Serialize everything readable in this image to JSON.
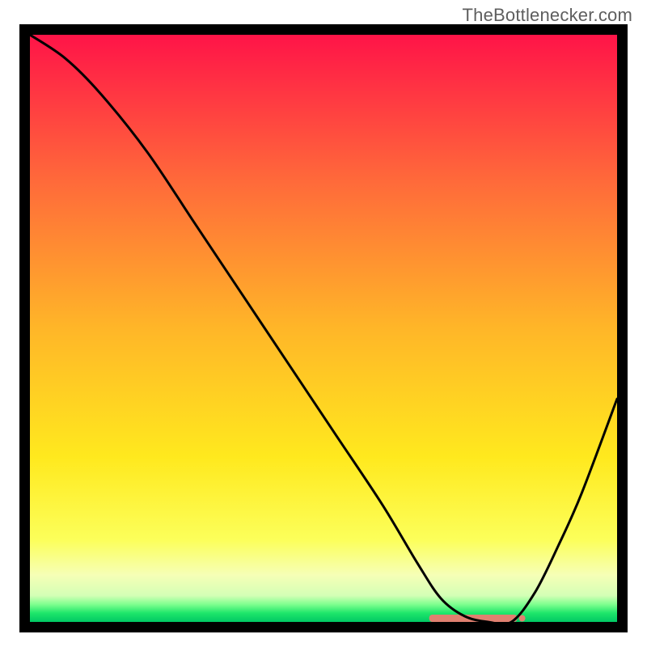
{
  "watermark": "TheBottlenecker.com",
  "chart_data": {
    "type": "line",
    "title": "",
    "xlabel": "",
    "ylabel": "",
    "xlim": [
      0,
      100
    ],
    "ylim": [
      0,
      100
    ],
    "x": [
      0,
      6,
      12,
      20,
      28,
      36,
      44,
      52,
      60,
      66,
      70,
      74,
      78,
      82,
      86,
      90,
      94,
      100
    ],
    "values": [
      100,
      96,
      90,
      80,
      68,
      56,
      44,
      32,
      20,
      10,
      4,
      1,
      0,
      0,
      5,
      13,
      22,
      38
    ],
    "background_gradient_stops": [
      {
        "offset": 0,
        "color": "#ff1448"
      },
      {
        "offset": 0.25,
        "color": "#ff6a3a"
      },
      {
        "offset": 0.5,
        "color": "#ffb628"
      },
      {
        "offset": 0.72,
        "color": "#ffe91e"
      },
      {
        "offset": 0.86,
        "color": "#fcff5a"
      },
      {
        "offset": 0.92,
        "color": "#f6ffb6"
      },
      {
        "offset": 0.955,
        "color": "#d4ffb6"
      },
      {
        "offset": 0.97,
        "color": "#7fff8f"
      },
      {
        "offset": 0.985,
        "color": "#1ee66a"
      },
      {
        "offset": 1.0,
        "color": "#00c864"
      }
    ],
    "baseline_marker": {
      "x_start": 68,
      "x_end": 83,
      "y": 0
    },
    "baseline_color": "#e08070",
    "curve_color": "#000000",
    "border_color": "#000000"
  }
}
